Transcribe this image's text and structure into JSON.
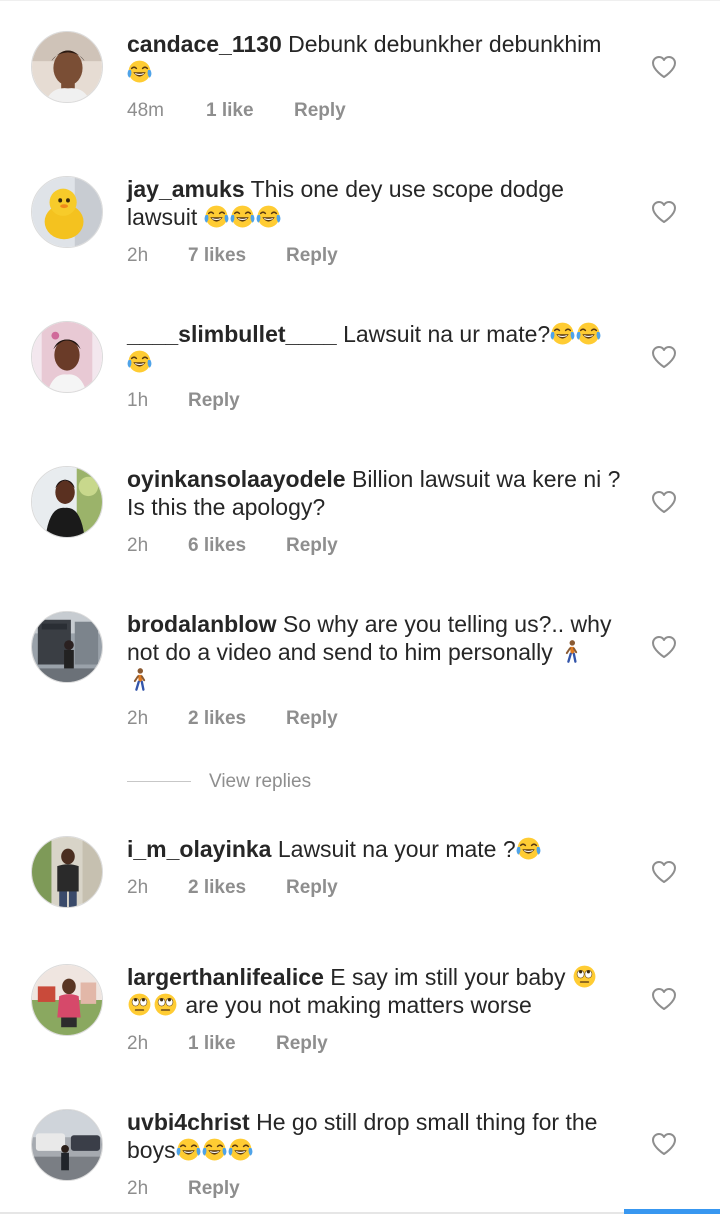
{
  "comments": [
    {
      "username": "candace_1130",
      "text": "Debunk debunkher debunkhim",
      "time": "48m",
      "likes": "1 like",
      "reply": "Reply"
    },
    {
      "username": "jay_amuks",
      "text": "This one dey use scope dodge lawsuit",
      "time": "2h",
      "likes": "7 likes",
      "reply": "Reply"
    },
    {
      "username": "____slimbullet____",
      "text": "Lawsuit na ur mate?",
      "time": "1h",
      "likes": "",
      "reply": "Reply"
    },
    {
      "username": "oyinkansolaayodele",
      "text": "Billion lawsuit wa kere ni ? Is this the apology?",
      "time": "2h",
      "likes": "6 likes",
      "reply": "Reply"
    },
    {
      "username": "brodalanblow",
      "text": "So why are you telling us?.. why not do a video and send to him personally",
      "time": "2h",
      "likes": "2 likes",
      "reply": "Reply"
    },
    {
      "username": "i_m_olayinka",
      "text": "Lawsuit na your mate ?",
      "time": "2h",
      "likes": "2 likes",
      "reply": "Reply"
    },
    {
      "username": "largerthanlifealice",
      "text": "E say im still your baby",
      "text2": "are you not making matters worse",
      "time": "2h",
      "likes": "1 like",
      "reply": "Reply"
    },
    {
      "username": "uvbi4christ",
      "text": "He go still drop small thing for the boys",
      "time": "2h",
      "likes": "",
      "reply": "Reply"
    }
  ],
  "view_replies": "View replies",
  "icons": {
    "heart": "heart-outline-icon",
    "laugh": "face-with-tears-of-joy-emoji",
    "walk": "person-walking-emoji",
    "roll": "face-with-rolling-eyes-emoji"
  },
  "colors": {
    "text": "#262626",
    "meta": "#8e8e8e",
    "accent": "#3897f0"
  }
}
